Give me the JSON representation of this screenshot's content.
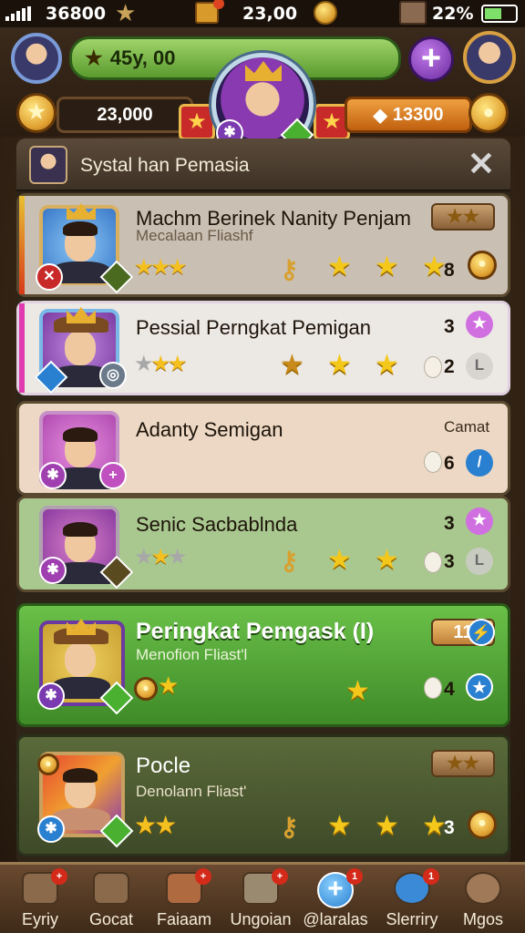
{
  "status_bar": {
    "signal_text": "36800",
    "center_value": "23,00",
    "battery_text": "22%"
  },
  "hud": {
    "xp_value": "45y, 00",
    "gold_value": "23,000",
    "gems_value": "13300",
    "plus_label": "+"
  },
  "panel": {
    "title": "Systal han Pemasia",
    "close_label": "✕"
  },
  "heroes": [
    {
      "name": "Machm Berinek Nanity Penjam",
      "subtitle": "Mecalaan Fliashf",
      "count": "8",
      "colors": {
        "bg": "#c9bfb2",
        "portrait": "#3a78c8"
      }
    },
    {
      "name": "Pessial Perngkat Pemigan",
      "subtitle": "",
      "count_top": "3",
      "count": "2",
      "colors": {
        "bg": "#ece8e4",
        "portrait": "#7a3aa0"
      }
    },
    {
      "name": "Adanty Semigan",
      "subtitle": "",
      "side_label": "Camat",
      "count": "6",
      "colors": {
        "bg": "#ecd8c4",
        "portrait": "#b04ab0"
      }
    },
    {
      "name": "Senic Sacbablnda",
      "subtitle": "",
      "count_top": "3",
      "count": "3",
      "colors": {
        "bg": "#a8c890",
        "portrait": "#8a3aa0"
      }
    },
    {
      "name": "Peringkat Pemgask (I)",
      "subtitle": "Menofion Fliast'l",
      "tag": "11",
      "count": "4",
      "colors": {
        "bg": "#58a838",
        "portrait": "#c8a030"
      }
    },
    {
      "name": "Pocle",
      "subtitle": "Denolann Fliast'",
      "count": "3",
      "colors": {
        "bg": "#4a5a30",
        "portrait": "#d84a30"
      }
    }
  ],
  "nav": [
    {
      "label": "Eyriy",
      "badge": "+",
      "icon": "house-icon"
    },
    {
      "label": "Gocat",
      "badge": "",
      "icon": "crate-icon"
    },
    {
      "label": "Faiaam",
      "badge": "+",
      "icon": "scroll-icon"
    },
    {
      "label": "Ungoian",
      "badge": "+",
      "icon": "beast-icon"
    },
    {
      "label": "@laralas",
      "badge": "1",
      "icon": "plus-icon",
      "active": true
    },
    {
      "label": "Slerriry",
      "badge": "1",
      "icon": "shield-icon"
    },
    {
      "label": "Mgos",
      "badge": "",
      "icon": "cookie-icon"
    }
  ],
  "accent_colors": {
    "gold": "#f4c020",
    "purple": "#8a3ab0",
    "green": "#58a838",
    "red": "#c82a2a"
  }
}
